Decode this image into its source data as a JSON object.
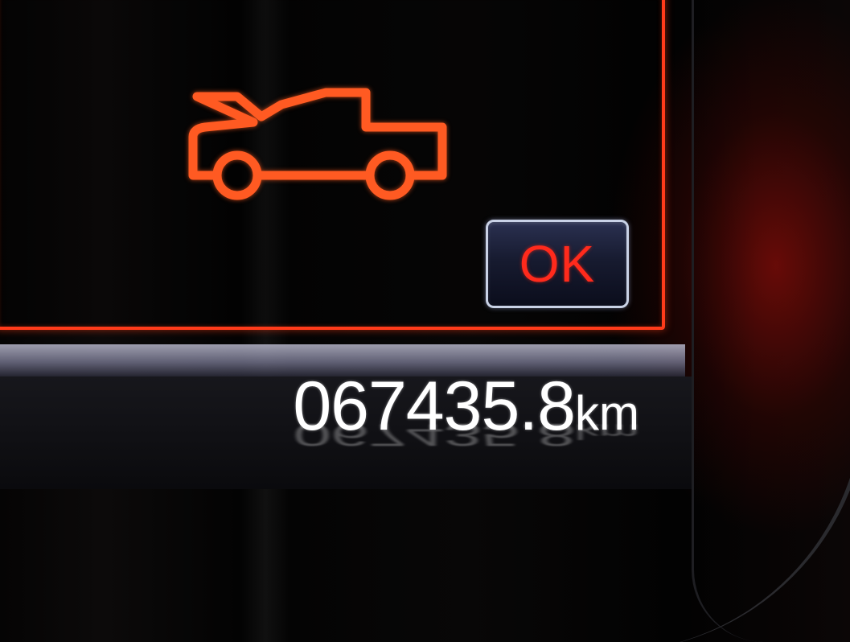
{
  "dashboard": {
    "warning": {
      "icon": "hood-open-icon",
      "color": "#ff3b1a"
    },
    "confirm_button": {
      "label": "OK",
      "label_color": "#ff2a1c"
    },
    "odometer": {
      "value": "067435.8",
      "unit": "km"
    }
  }
}
